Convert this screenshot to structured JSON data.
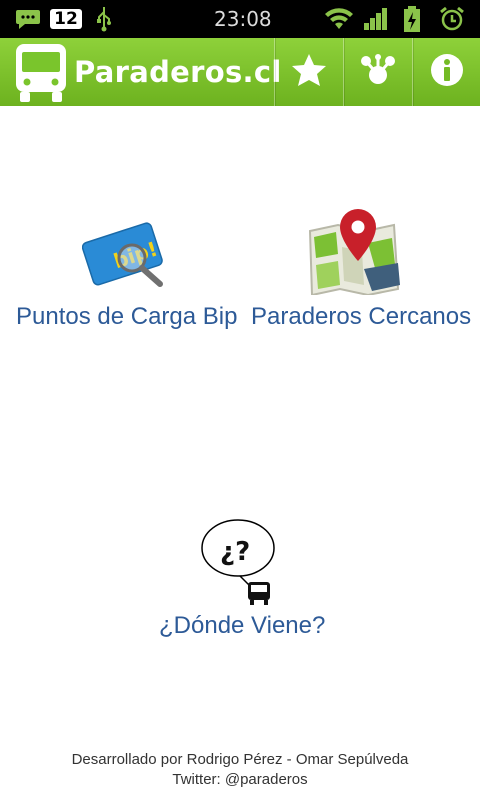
{
  "status_bar": {
    "notification_count": "12",
    "time": "23:08",
    "icons": [
      "chat-bubble-icon",
      "usb-icon",
      "wifi-icon",
      "signal-icon",
      "battery-icon",
      "alarm-icon"
    ]
  },
  "app": {
    "title": "Paraderos.cl",
    "brand_color": "#7ac52c",
    "actions": [
      {
        "icon": "star-icon",
        "label": "Favoritos"
      },
      {
        "icon": "network-icon",
        "label": "Red"
      },
      {
        "icon": "info-icon",
        "label": "Info"
      }
    ]
  },
  "menu": {
    "bip": {
      "label": "Puntos de Carga Bip",
      "icon": "bip-card-search-icon",
      "card_text": "bip!"
    },
    "nearby": {
      "label": "Paraderos Cercanos",
      "icon": "map-pin-icon"
    },
    "where": {
      "label": "¿Dónde Viene?",
      "icon": "bus-question-icon",
      "bubble_text": "¿?"
    }
  },
  "footer": {
    "credits": "Desarrollado por Rodrigo Pérez - Omar Sepúlveda",
    "twitter": "Twitter: @paraderos"
  },
  "colors": {
    "label": "#2d5a97",
    "statusbar": "#000000"
  }
}
